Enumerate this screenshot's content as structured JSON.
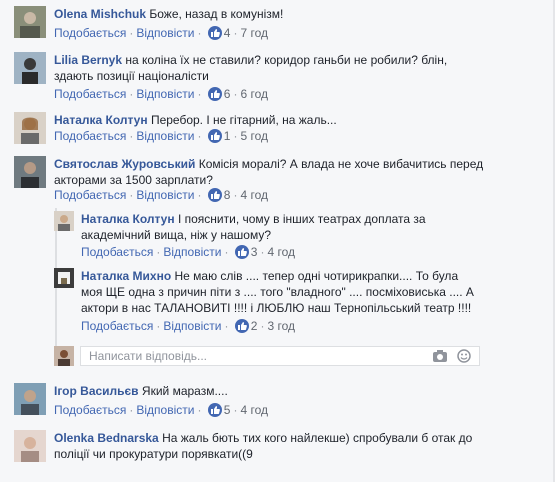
{
  "actions": {
    "like": "Подобається",
    "reply": "Відповісти"
  },
  "comments": [
    {
      "author": "Olena Mishchuk",
      "text": "Боже, назад в комунізм!",
      "likes": "4",
      "time": "7 год"
    },
    {
      "author": "Lilia Bernyk",
      "text_l1": "на коліна їх не ставили? коридор ганьби не робили? блін,",
      "text_l2": "здають позиції націоналісти",
      "likes": "6",
      "time": "6 год"
    },
    {
      "author": "Наталка Колтун",
      "text": "Перебор. І не гітарний, на жаль...",
      "likes": "1",
      "time": "5 год"
    },
    {
      "author": "Святослав Журовський",
      "text_l1": "Комісія моралі? А влада не хоче вибачитись перед",
      "text_l2": "акторами за 1500 зарплати?",
      "likes": "8",
      "time": "4 год"
    }
  ],
  "replies": [
    {
      "author": "Наталка Колтун",
      "text_l1": "І пояснити, чому в інших театрах доплата за",
      "text_l2": "академічний вища, ніж у нашому?",
      "likes": "3",
      "time": "4 год"
    },
    {
      "author": "Наталка Михно",
      "text_l1": "Не маю слів .... тепер одні чотирикрапки.... То була",
      "text_l2": "моя ЩЕ одна з причин піти з .... того \"владного\" .... посміховиська .... А",
      "text_l3": "актори в нас ТАЛАНОВИТІ !!!! і ЛЮБЛЮ наш Тернопільський театр !!!!",
      "likes": "2",
      "time": "3 год"
    }
  ],
  "composer": {
    "placeholder": "Написати відповідь..."
  },
  "more": [
    {
      "author": "Ігор Васильєв",
      "text": "Який маразм....",
      "likes": "5",
      "time": "4 год"
    },
    {
      "author": "Olenka Bednarska",
      "text_l1": "На жаль бють тих кого найлекше) спробували б отак до",
      "text_l2": "поліції чи прокуратури порявкати((9",
      "likes": "",
      "time": ""
    }
  ]
}
